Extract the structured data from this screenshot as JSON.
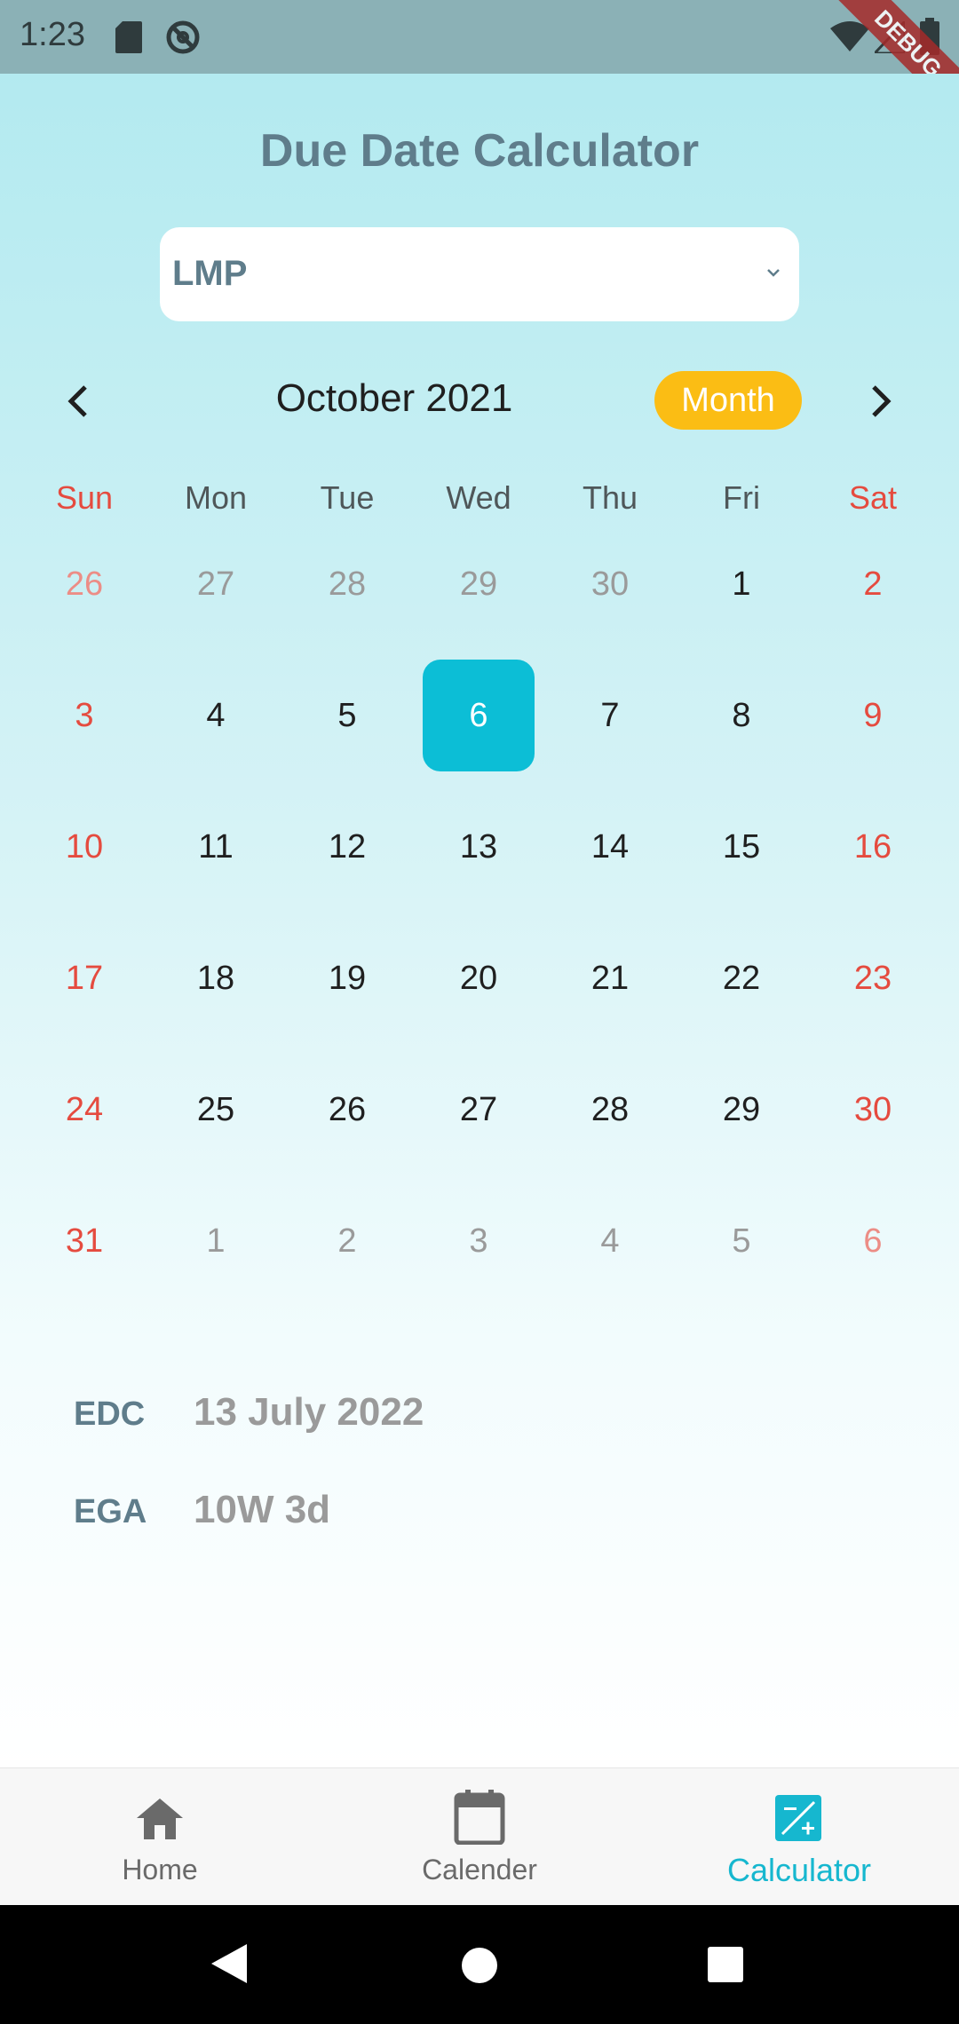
{
  "status_bar": {
    "time": "1:23"
  },
  "debug_banner": "DEBUG",
  "app": {
    "title": "Due Date Calculator"
  },
  "method_dropdown": {
    "value": "LMP"
  },
  "calendar": {
    "month_title": "October 2021",
    "format_button": "Month",
    "weekdays": [
      "Sun",
      "Mon",
      "Tue",
      "Wed",
      "Thu",
      "Fri",
      "Sat"
    ],
    "weeks": [
      [
        "26",
        "27",
        "28",
        "29",
        "30",
        "1",
        "2"
      ],
      [
        "3",
        "4",
        "5",
        "6",
        "7",
        "8",
        "9"
      ],
      [
        "10",
        "11",
        "12",
        "13",
        "14",
        "15",
        "16"
      ],
      [
        "17",
        "18",
        "19",
        "20",
        "21",
        "22",
        "23"
      ],
      [
        "24",
        "25",
        "26",
        "27",
        "28",
        "29",
        "30"
      ],
      [
        "31",
        "1",
        "2",
        "3",
        "4",
        "5",
        "6"
      ]
    ],
    "selected_day": "6"
  },
  "results": {
    "edc_label": "EDC",
    "edc_value": "13 July 2022",
    "ega_label": "EGA",
    "ega_value": "10W 3d"
  },
  "bottom_nav": {
    "items": [
      {
        "label": "Home",
        "icon": "home-icon"
      },
      {
        "label": "Calender",
        "icon": "calendar-icon"
      },
      {
        "label": "Calculator",
        "icon": "calculator-icon"
      }
    ],
    "active_index": 2
  },
  "colors": {
    "accent": "#0cbed6",
    "pill": "#fbbd14",
    "weekend": "#e54b3f",
    "title": "#5f7d8b"
  }
}
